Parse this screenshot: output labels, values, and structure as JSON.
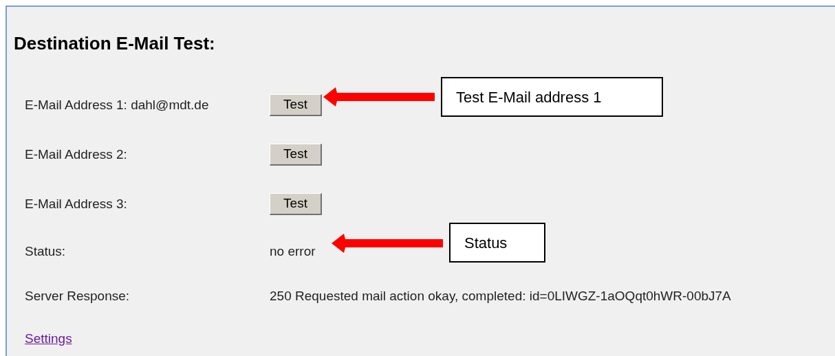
{
  "title": "Destination E-Mail Test:",
  "rows": [
    {
      "kind": "button",
      "label": "E-Mail Address 1: dahl@mdt.de",
      "button": "Test"
    },
    {
      "kind": "button",
      "label": "E-Mail Address 2:",
      "button": "Test"
    },
    {
      "kind": "button",
      "label": "E-Mail Address 3:",
      "button": "Test"
    },
    {
      "kind": "text",
      "label": "Status:",
      "value": "no error"
    },
    {
      "kind": "text",
      "label": "Server Response:",
      "value": "250 Requested mail action okay, completed: id=0LIWGZ-1aOQqt0hWR-00bJ7A"
    }
  ],
  "link": "Settings",
  "callouts": [
    {
      "text": "Test E-Mail address 1"
    },
    {
      "text": "Status"
    }
  ]
}
